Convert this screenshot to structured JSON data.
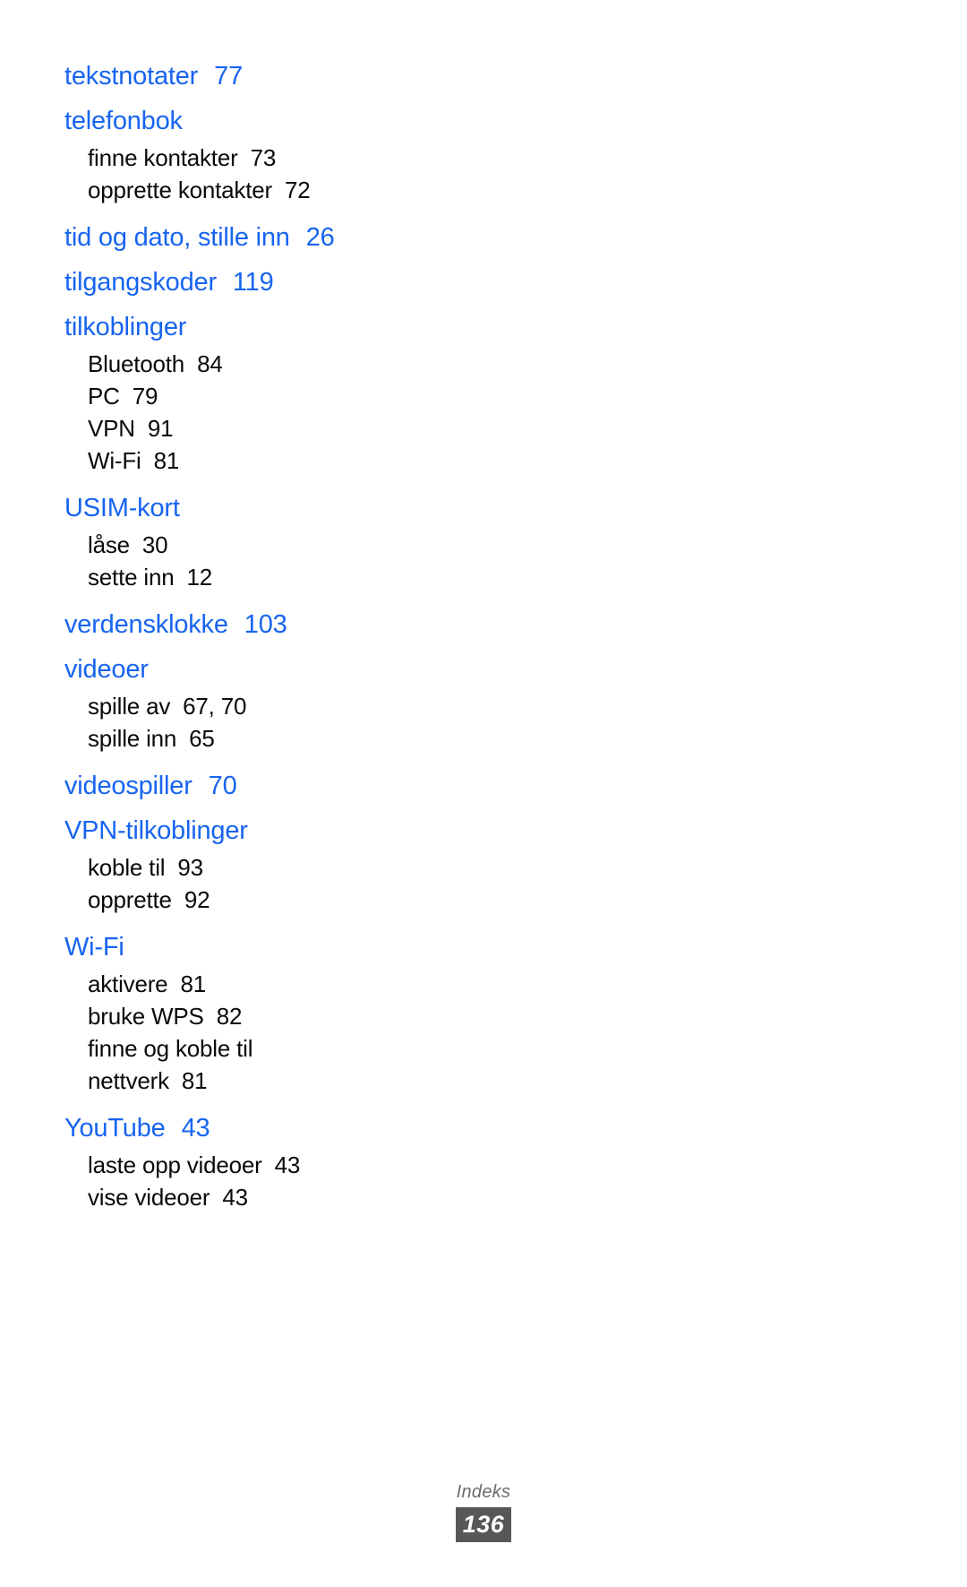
{
  "document": {
    "type": "index",
    "language": "nb-NO",
    "colors": {
      "heading_blue": "#1764f0",
      "body_black": "#0a0a0a",
      "footer_gray": "#6b6b6b",
      "badge_background": "#575757",
      "badge_text": "#ffffff",
      "page_background": "#ffffff"
    }
  },
  "index": {
    "groups": [
      {
        "term": "tekstnotater",
        "pages": "77",
        "subentries": []
      },
      {
        "term": "telefonbok",
        "pages": "",
        "subentries": [
          {
            "term": "finne kontakter",
            "pages": "73"
          },
          {
            "term": "opprette kontakter",
            "pages": "72"
          }
        ]
      },
      {
        "term": "tid og dato, stille inn",
        "pages": "26",
        "subentries": []
      },
      {
        "term": "tilgangskoder",
        "pages": "119",
        "subentries": []
      },
      {
        "term": "tilkoblinger",
        "pages": "",
        "subentries": [
          {
            "term": "Bluetooth",
            "pages": "84"
          },
          {
            "term": "PC",
            "pages": "79"
          },
          {
            "term": "VPN",
            "pages": "91"
          },
          {
            "term": "Wi-Fi",
            "pages": "81"
          }
        ]
      },
      {
        "term": "USIM-kort",
        "pages": "",
        "subentries": [
          {
            "term": "låse",
            "pages": "30"
          },
          {
            "term": "sette inn",
            "pages": "12"
          }
        ]
      },
      {
        "term": "verdensklokke",
        "pages": "103",
        "subentries": []
      },
      {
        "term": "videoer",
        "pages": "",
        "subentries": [
          {
            "term": "spille av",
            "pages": "67, 70"
          },
          {
            "term": "spille inn",
            "pages": "65"
          }
        ]
      },
      {
        "term": "videospiller",
        "pages": "70",
        "subentries": []
      },
      {
        "term": "VPN-tilkoblinger",
        "pages": "",
        "subentries": [
          {
            "term": "koble til",
            "pages": "93"
          },
          {
            "term": "opprette",
            "pages": "92"
          }
        ]
      },
      {
        "term": "Wi-Fi",
        "pages": "",
        "subentries": [
          {
            "term": "aktivere",
            "pages": "81"
          },
          {
            "term": "bruke WPS",
            "pages": "82"
          },
          {
            "term": "finne og koble til",
            "pages": ""
          },
          {
            "term": "nettverk",
            "pages": "81"
          }
        ]
      },
      {
        "term": "YouTube",
        "pages": "43",
        "subentries": [
          {
            "term": "laste opp videoer",
            "pages": "43"
          },
          {
            "term": "vise videoer",
            "pages": "43"
          }
        ]
      }
    ]
  },
  "footer": {
    "section_label": "Indeks",
    "page_number": "136"
  }
}
